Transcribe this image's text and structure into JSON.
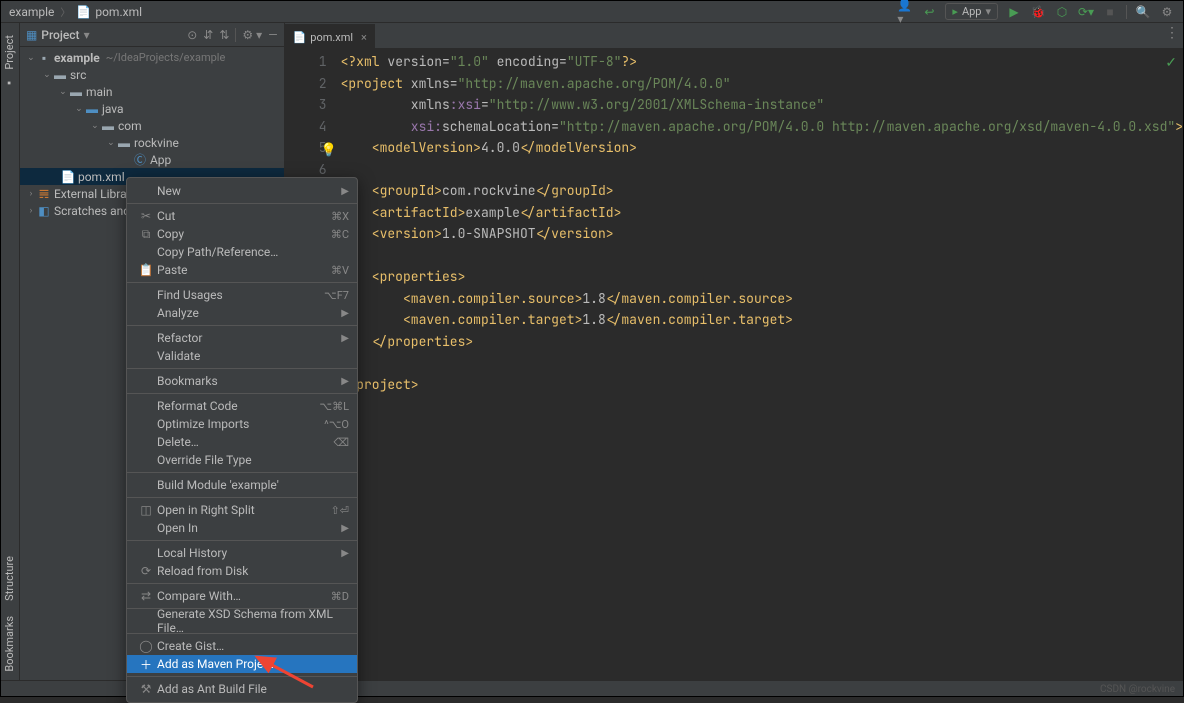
{
  "breadcrumb": {
    "root": "example",
    "file": "pom.xml"
  },
  "toolbar": {
    "run_config": "App"
  },
  "project_panel": {
    "title": "Project"
  },
  "tree": {
    "root": "example",
    "root_path": "~/IdeaProjects/example",
    "src": "src",
    "main": "main",
    "java": "java",
    "com": "com",
    "rockvine": "rockvine",
    "app": "App",
    "pom": "pom.xml",
    "ext_lib": "External Libraries",
    "scratch": "Scratches and Consoles"
  },
  "editor": {
    "tab_label": "pom.xml"
  },
  "gutter_lines": [
    "1",
    "2",
    "3",
    "4",
    "5",
    "6"
  ],
  "context_menu": {
    "new": "New",
    "cut": "Cut",
    "cut_sc": "⌘X",
    "copy": "Copy",
    "copy_sc": "⌘C",
    "copy_path": "Copy Path/Reference…",
    "paste": "Paste",
    "paste_sc": "⌘V",
    "find_usages": "Find Usages",
    "find_usages_sc": "⌥F7",
    "analyze": "Analyze",
    "refactor": "Refactor",
    "validate": "Validate",
    "bookmarks": "Bookmarks",
    "reformat": "Reformat Code",
    "reformat_sc": "⌥⌘L",
    "optimize": "Optimize Imports",
    "optimize_sc": "^⌥O",
    "delete": "Delete…",
    "delete_sc": "⌫",
    "override": "Override File Type",
    "build": "Build Module 'example'",
    "open_split": "Open in Right Split",
    "open_split_sc": "⇧⏎",
    "open_in": "Open In",
    "history": "Local History",
    "reload": "Reload from Disk",
    "compare": "Compare With…",
    "compare_sc": "⌘D",
    "xsd": "Generate XSD Schema from XML File…",
    "gist": "Create Gist…",
    "maven": "Add as Maven Project",
    "ant": "Add as Ant Build File"
  },
  "side_tabs": {
    "project": "Project",
    "structure": "Structure",
    "bookmarks": "Bookmarks"
  },
  "watermark": "CSDN @rockvine"
}
